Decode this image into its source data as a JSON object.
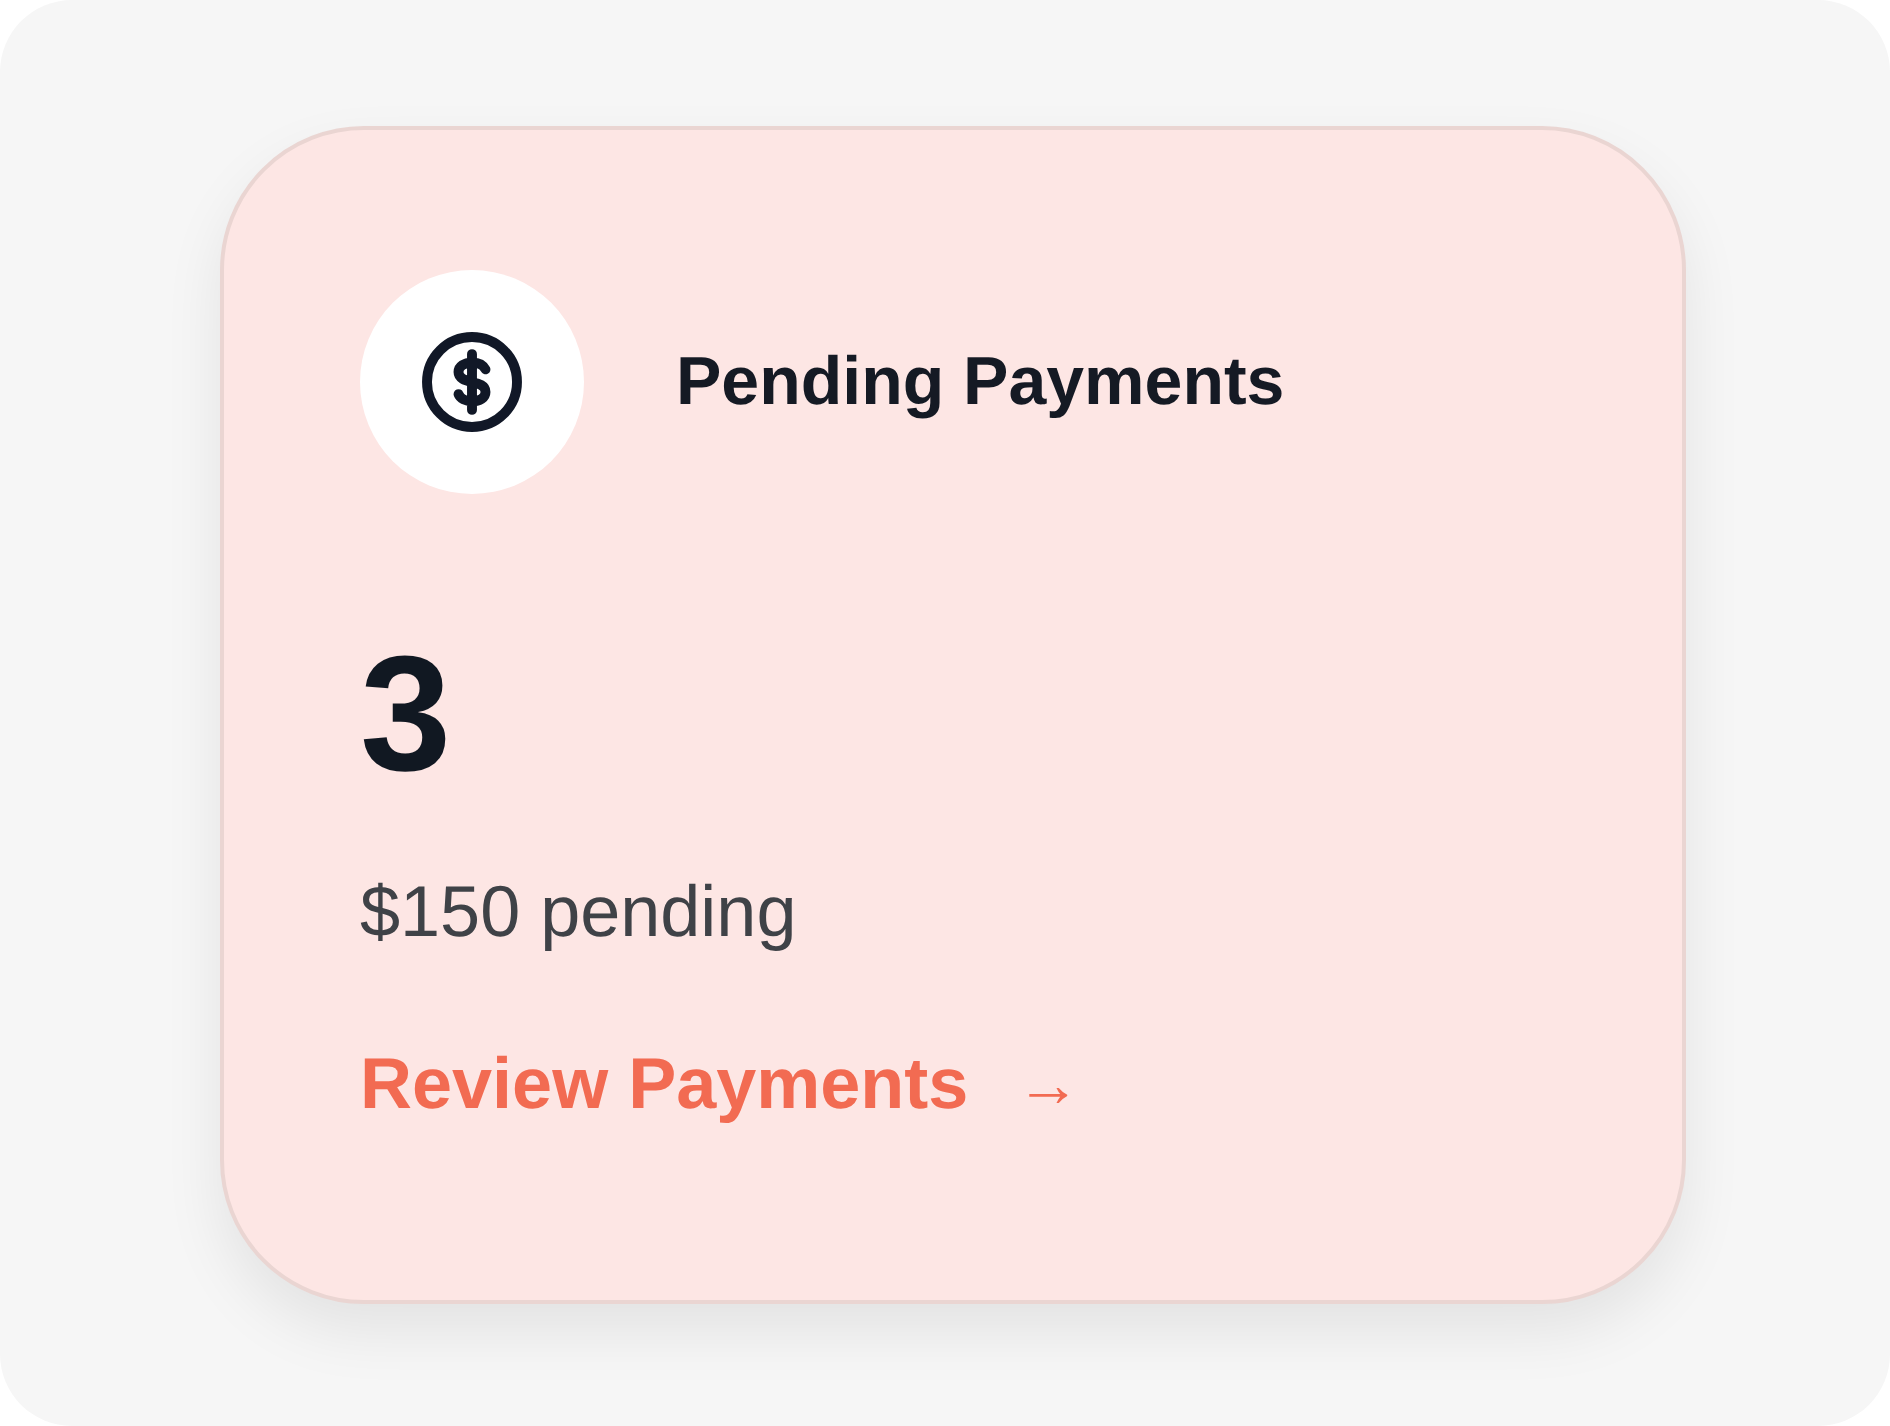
{
  "card": {
    "title": "Pending Payments",
    "count": "3",
    "subtitle": "$150 pending",
    "link": {
      "label": "Review Payments",
      "arrow": "→"
    }
  }
}
